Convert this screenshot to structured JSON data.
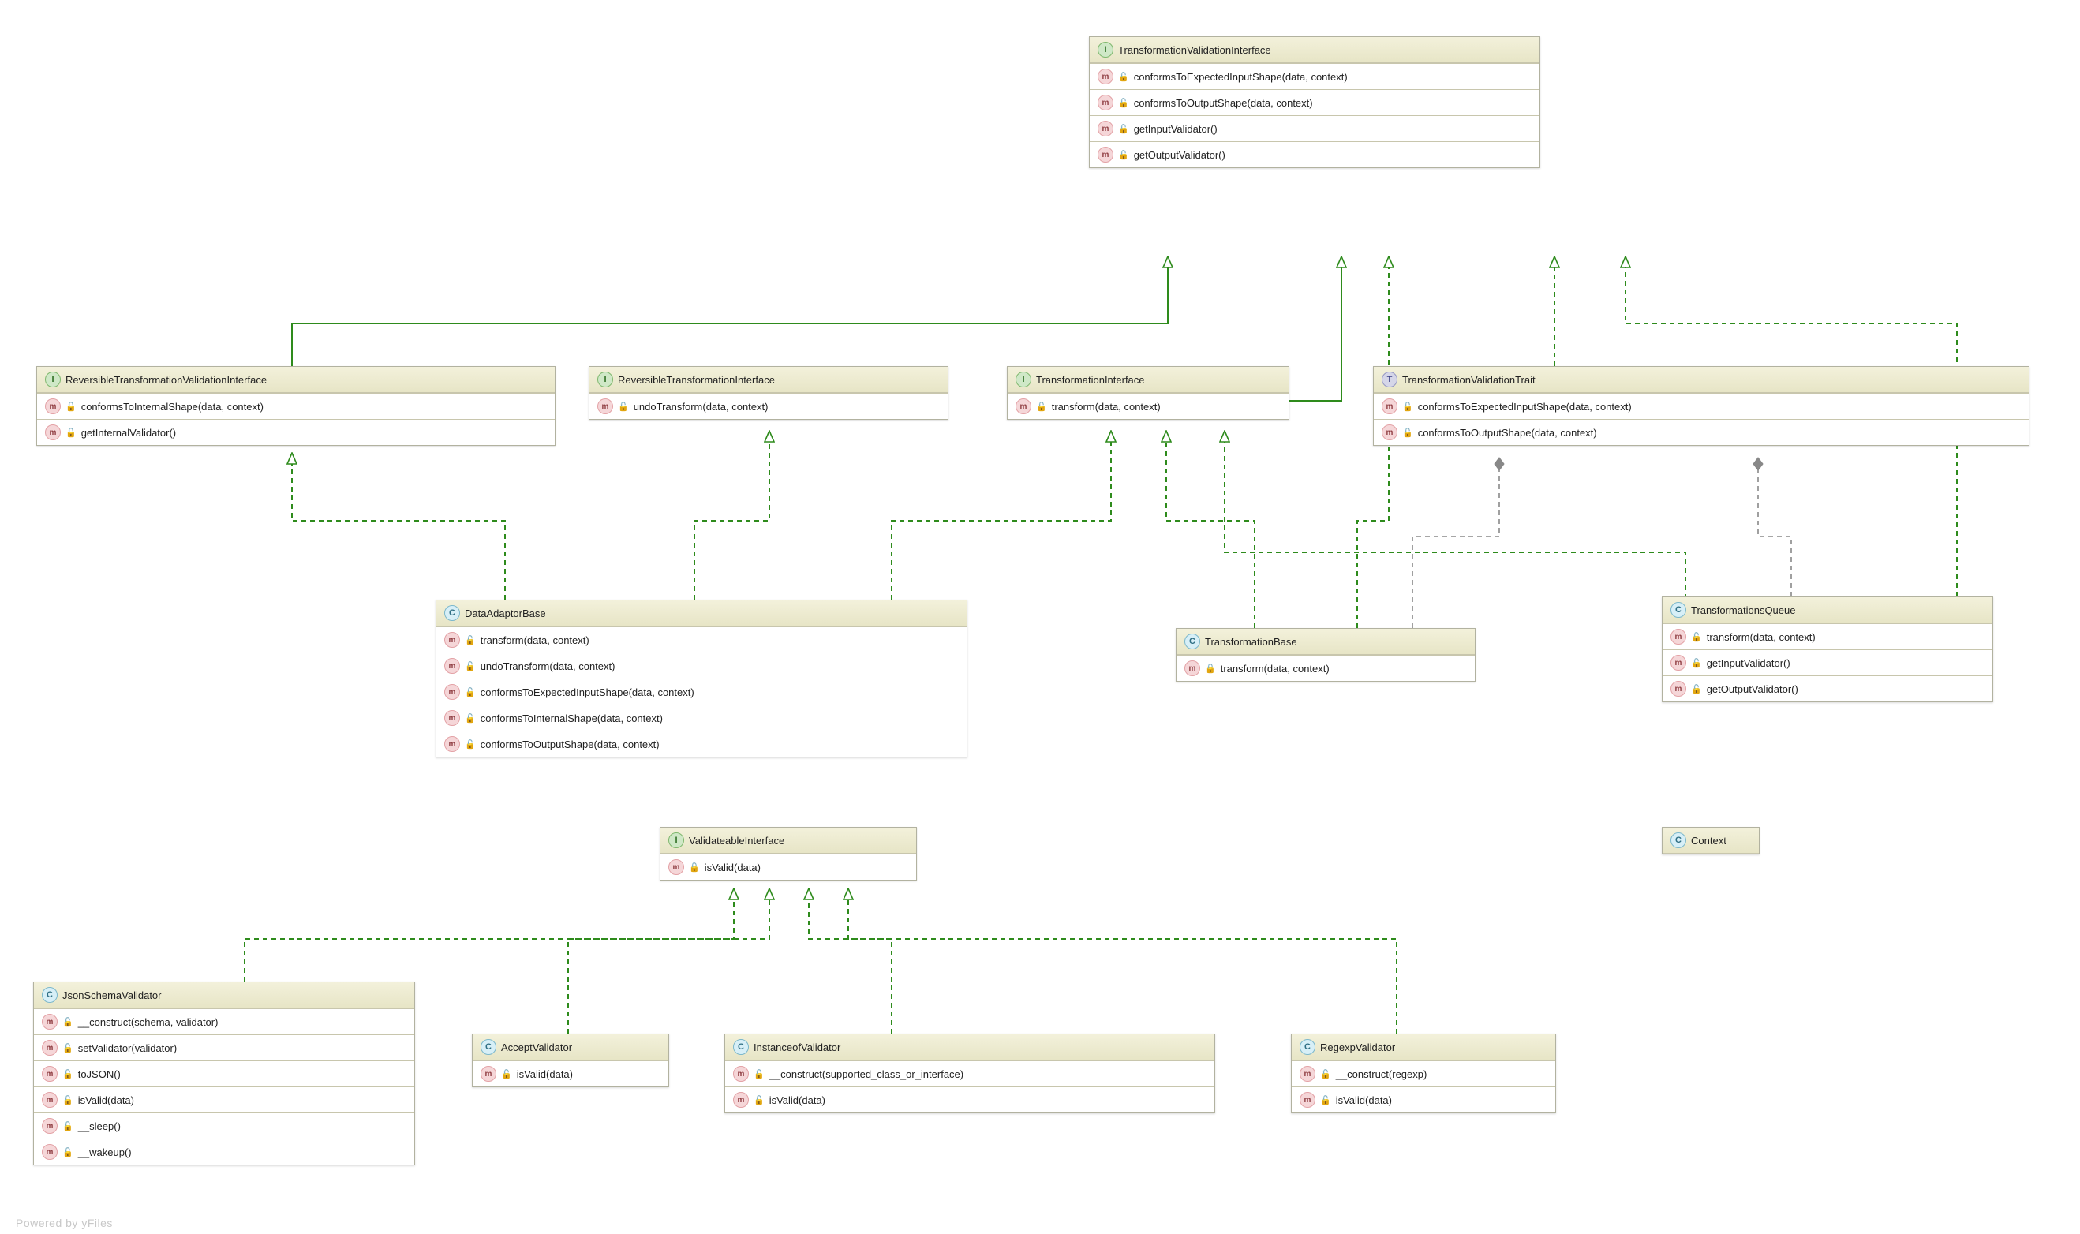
{
  "footer": "Powered by yFiles",
  "kind_labels": {
    "I": "I",
    "C": "C",
    "T": "T",
    "m": "m"
  },
  "boxes": {
    "tvi": {
      "kind": "I",
      "name": "TransformationValidationInterface",
      "members": [
        "conformsToExpectedInputShape(data, context)",
        "conformsToOutputShape(data, context)",
        "getInputValidator()",
        "getOutputValidator()"
      ]
    },
    "rtvi": {
      "kind": "I",
      "name": "ReversibleTransformationValidationInterface",
      "members": [
        "conformsToInternalShape(data, context)",
        "getInternalValidator()"
      ]
    },
    "rti": {
      "kind": "I",
      "name": "ReversibleTransformationInterface",
      "members": [
        "undoTransform(data, context)"
      ]
    },
    "ti": {
      "kind": "I",
      "name": "TransformationInterface",
      "members": [
        "transform(data, context)"
      ]
    },
    "tvt": {
      "kind": "T",
      "name": "TransformationValidationTrait",
      "members": [
        "conformsToExpectedInputShape(data, context)",
        "conformsToOutputShape(data, context)"
      ]
    },
    "dab": {
      "kind": "C",
      "name": "DataAdaptorBase",
      "members": [
        "transform(data, context)",
        "undoTransform(data, context)",
        "conformsToExpectedInputShape(data, context)",
        "conformsToInternalShape(data, context)",
        "conformsToOutputShape(data, context)"
      ]
    },
    "tb": {
      "kind": "C",
      "name": "TransformationBase",
      "members": [
        "transform(data, context)"
      ]
    },
    "tq": {
      "kind": "C",
      "name": "TransformationsQueue",
      "members": [
        "transform(data, context)",
        "getInputValidator()",
        "getOutputValidator()"
      ]
    },
    "vi": {
      "kind": "I",
      "name": "ValidateableInterface",
      "members": [
        "isValid(data)"
      ]
    },
    "jsv": {
      "kind": "C",
      "name": "JsonSchemaValidator",
      "members": [
        "__construct(schema, validator)",
        "setValidator(validator)",
        "toJSON()",
        "isValid(data)",
        "__sleep()",
        "__wakeup()"
      ]
    },
    "av": {
      "kind": "C",
      "name": "AcceptValidator",
      "members": [
        "isValid(data)"
      ]
    },
    "iov": {
      "kind": "C",
      "name": "InstanceofValidator",
      "members": [
        "__construct(supported_class_or_interface)",
        "isValid(data)"
      ]
    },
    "rv": {
      "kind": "C",
      "name": "RegexpValidator",
      "members": [
        "__construct(regexp)",
        "isValid(data)"
      ]
    },
    "ctx": {
      "kind": "C",
      "name": "Context",
      "members": []
    }
  }
}
